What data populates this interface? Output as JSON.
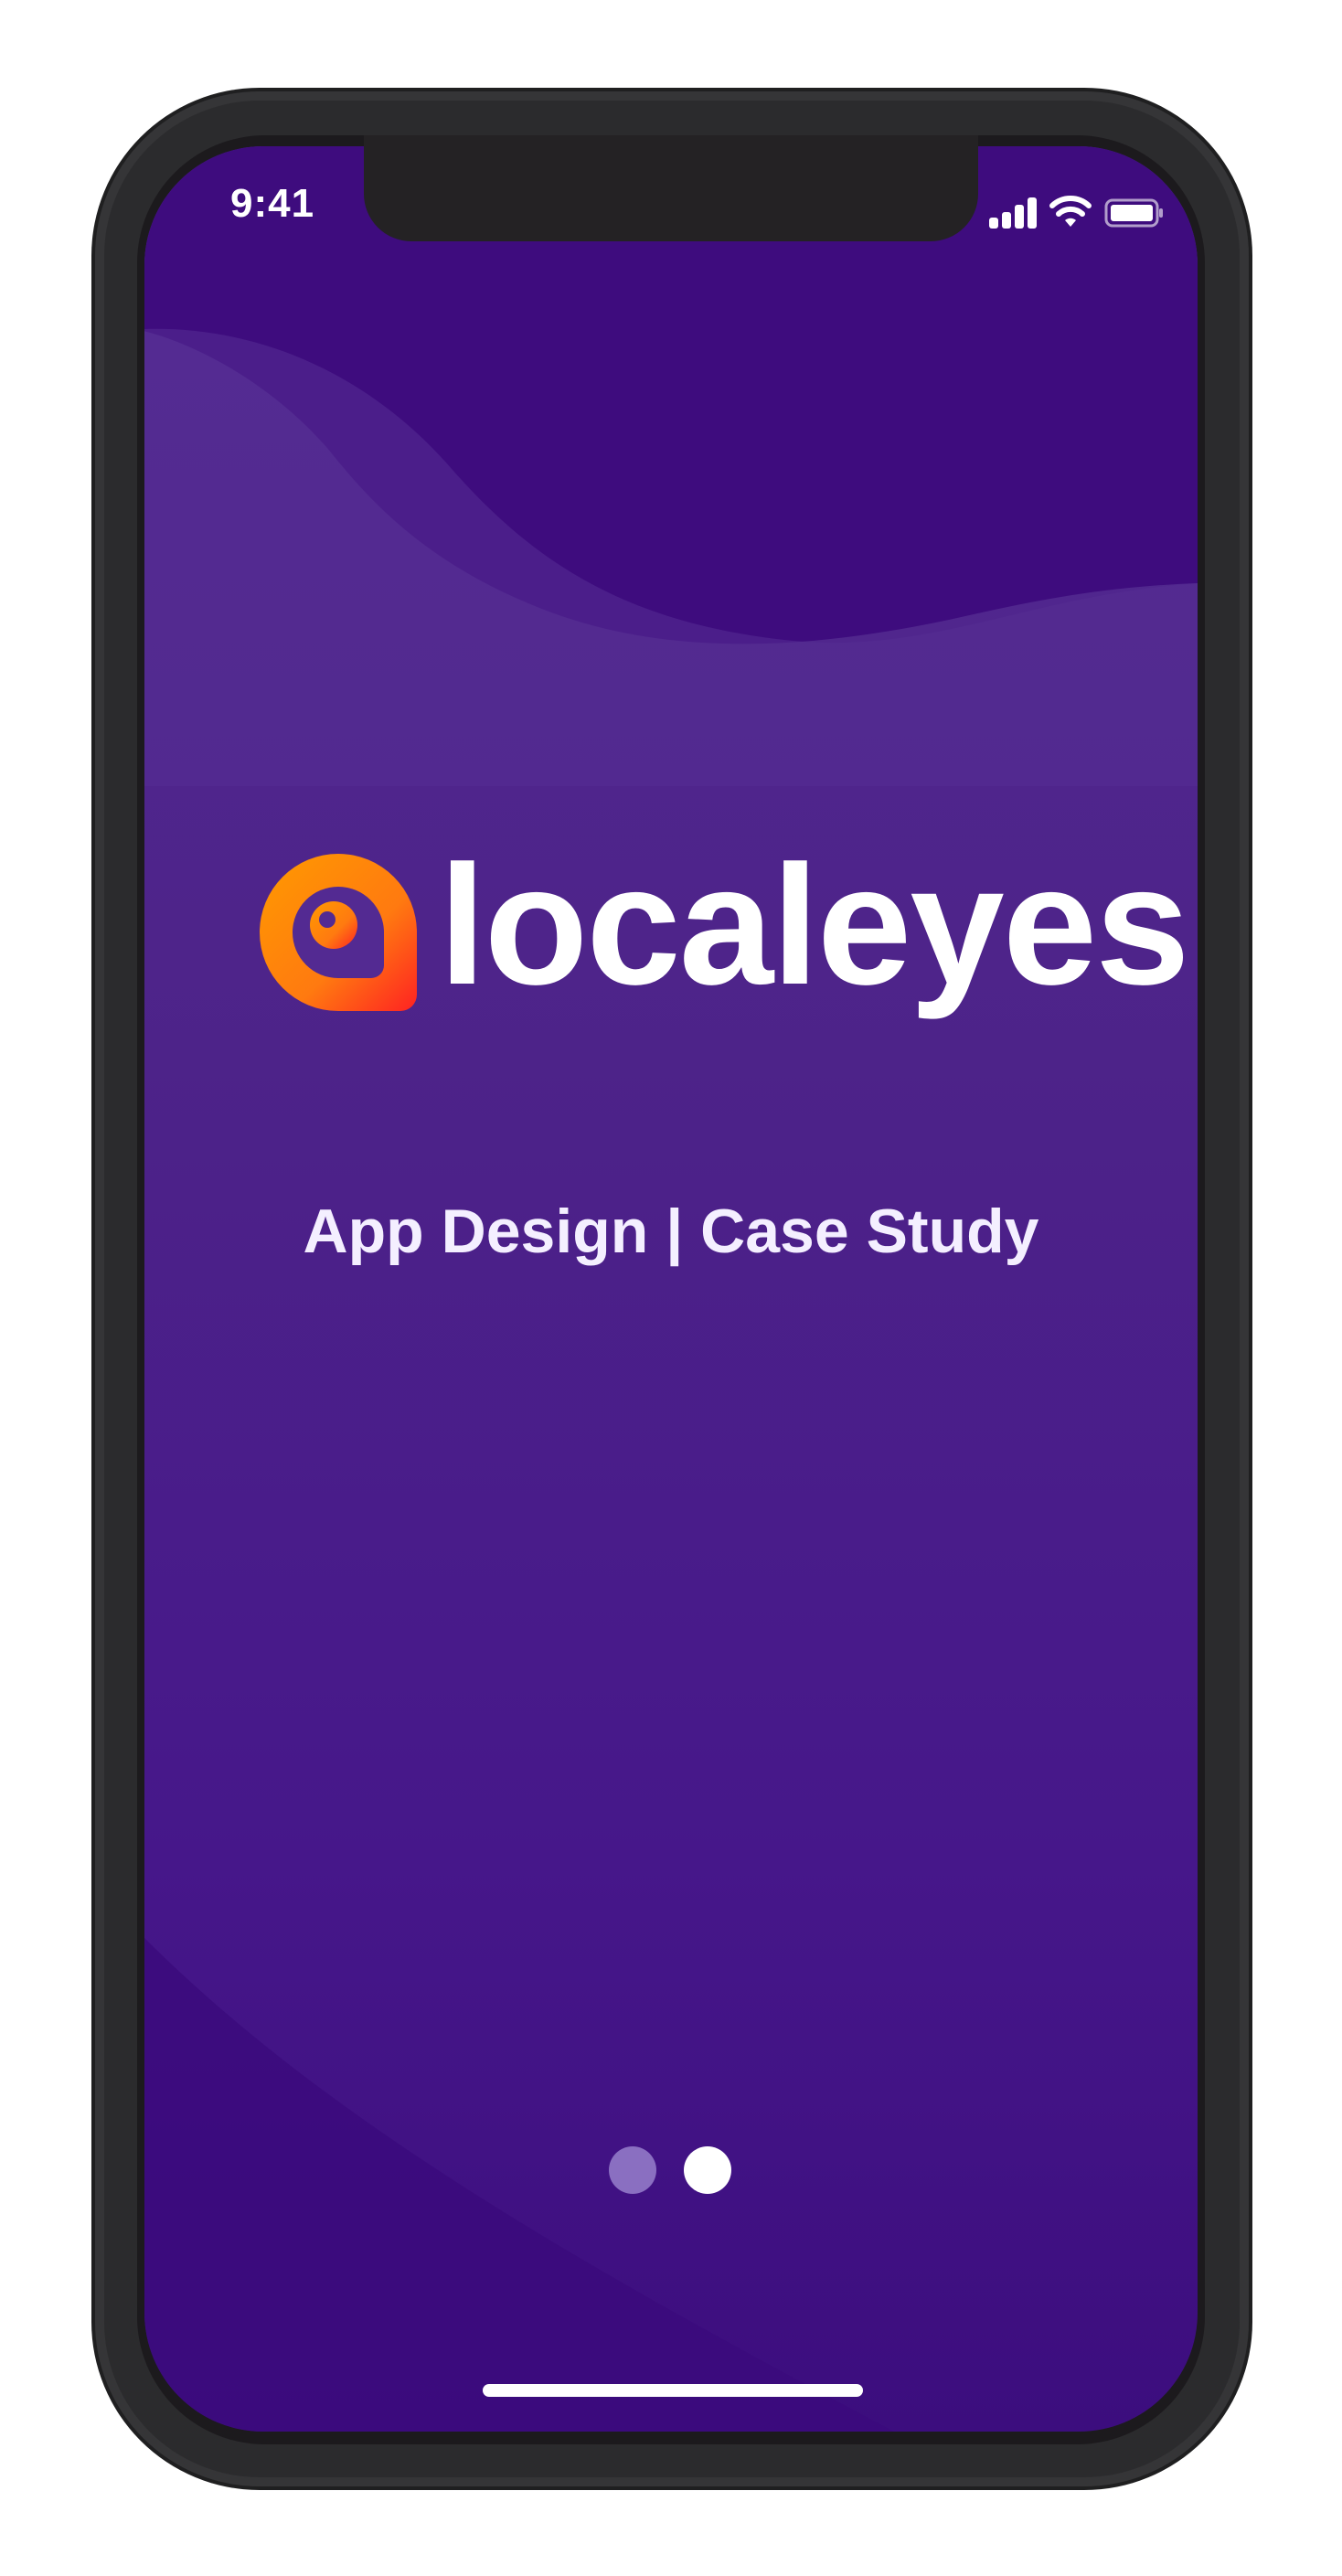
{
  "status_bar": {
    "time": "9:41",
    "signal_icon": "cellular-signal-icon",
    "wifi_icon": "wifi-icon",
    "battery_icon": "battery-icon"
  },
  "splash": {
    "brand_name": "localeyes",
    "logo_icon": "localeyes-logo-icon",
    "tagline": "App Design | Case Study"
  },
  "pagination": {
    "total_pages": 2,
    "active_page": 2
  },
  "colors": {
    "background_top": "#532a92",
    "background_bottom": "#3c0d7e",
    "logo_orange": "#ff8c00",
    "logo_red": "#ff2e1f",
    "text": "#ffffff"
  }
}
